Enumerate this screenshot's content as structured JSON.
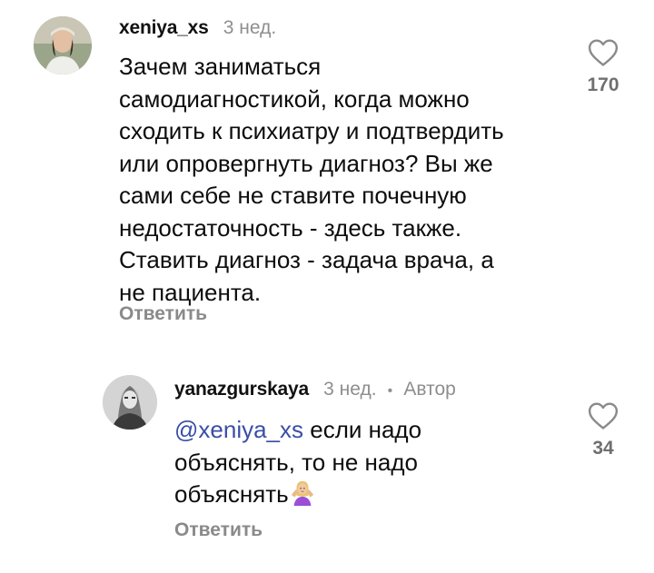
{
  "comments": [
    {
      "username": "xeniya_xs",
      "time": "3 нед.",
      "text_lines": [
        "Зачем заниматься",
        "самодиагностикой, когда можно",
        "сходить к психиатру и подтвердить",
        "или опровергнуть диагноз? Вы же",
        "сами себе не ставите почечную",
        "недостаточность - здесь также.",
        "Ставить диагноз - задача врача, а",
        "не пациента."
      ],
      "reply_label": "Ответить",
      "likes": "170",
      "like_icon": "heart-outline-icon"
    },
    {
      "username": "yanazgurskaya",
      "time": "3 нед.",
      "dot": "•",
      "author_badge": "Автор",
      "mention": "@xeniya_xs",
      "text_first": " если надо",
      "text_lines": [
        "объяснять, то не надо",
        "объяснять"
      ],
      "emoji": "woman-shrugging-emoji",
      "reply_label": "Ответить",
      "likes": "34",
      "like_icon": "heart-outline-icon"
    }
  ]
}
